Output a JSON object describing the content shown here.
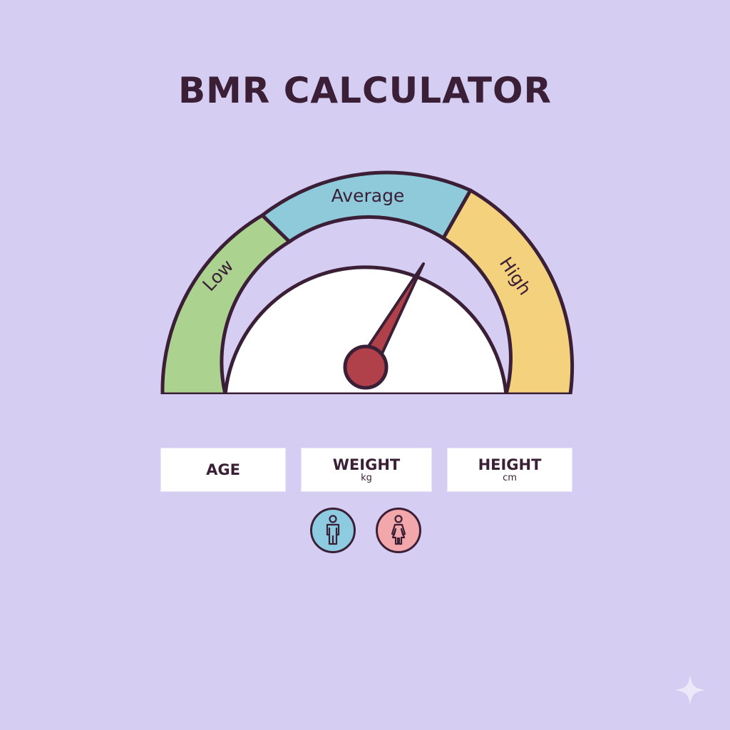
{
  "title": "BMR CALCULATOR",
  "gauge": {
    "zones": [
      {
        "label": "Low",
        "color": "#acd28f"
      },
      {
        "label": "Average",
        "color": "#8fcadb"
      },
      {
        "label": "High",
        "color": "#f4d27d"
      }
    ],
    "needle_color": "#b0404a",
    "needle_level_fraction": 0.62
  },
  "fields": {
    "age": {
      "label": "AGE"
    },
    "weight": {
      "label": "WEIGHT",
      "unit": "kg"
    },
    "height": {
      "label": "HEIGHT",
      "unit": "cm"
    }
  },
  "gender": {
    "male_icon": "male-person-icon",
    "female_icon": "female-person-icon",
    "male_color": "#8ccbe0",
    "female_color": "#f2a7ab"
  },
  "colors": {
    "background": "#d6cdf3",
    "outline": "#3b1f36"
  }
}
